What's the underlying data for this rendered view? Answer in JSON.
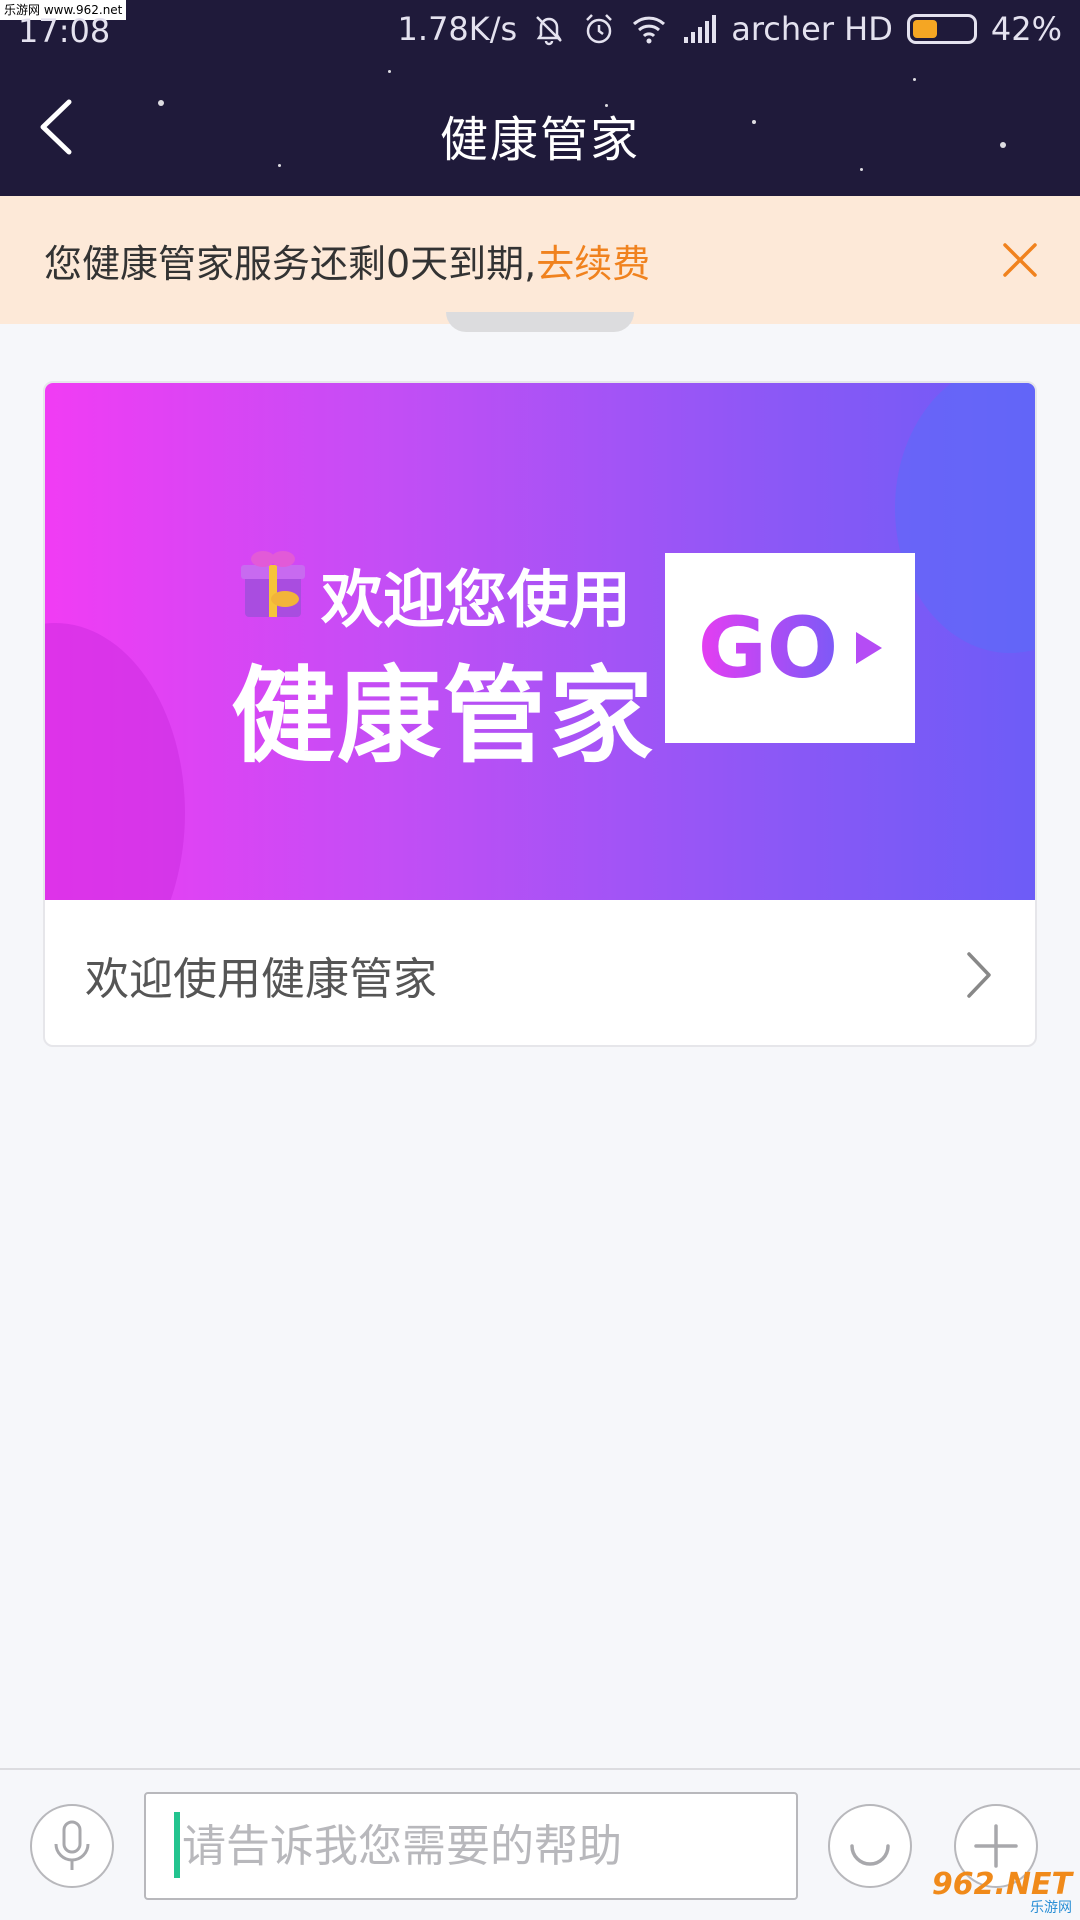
{
  "watermark_top": "乐游网 www.962.net",
  "status_bar": {
    "time": "17:08",
    "speed": "1.78K/s",
    "carrier": "archer HD",
    "battery_percent": "42%",
    "battery_level": 0.42,
    "icons": [
      "mute-icon",
      "alarm-icon",
      "wifi-icon",
      "signal-icon",
      "battery-icon"
    ]
  },
  "title_bar": {
    "title": "健康管家",
    "back_icon": "back-arrow-icon"
  },
  "notice": {
    "text": "您健康管家服务还剩0天到期,",
    "link": "去续费",
    "close_icon": "close-icon",
    "link_color": "#f0821e"
  },
  "banner": {
    "line1": "欢迎您使用",
    "line2": "健康管家",
    "go": "GO",
    "icon": "gift-icon"
  },
  "card": {
    "label": "欢迎使用健康管家",
    "chevron_icon": "chevron-right-icon"
  },
  "input_bar": {
    "placeholder": "请告诉我您需要的帮助",
    "left_icon": "microphone-icon",
    "emoji_icon": "smile-icon",
    "add_icon": "plus-icon"
  },
  "logo_watermark": {
    "main": "962.NET",
    "sub": "乐游网"
  },
  "colors": {
    "header_bg": "#1f1a3a",
    "notice_bg": "#fde9d8",
    "accent_orange": "#f0821e",
    "caret_green": "#23c48f",
    "banner_gradient_start": "#f13cf4",
    "banner_gradient_end": "#6d5cf7"
  }
}
